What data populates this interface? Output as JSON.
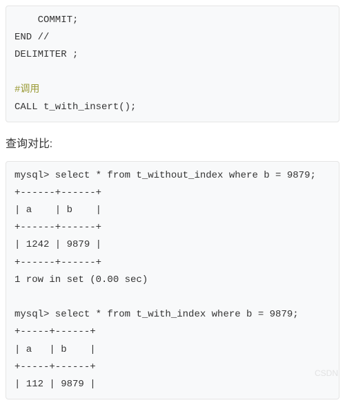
{
  "code1": {
    "line1": "    COMMIT;",
    "line2": "END //",
    "line3": "DELIMITER ;",
    "blank": "",
    "comment": "#调用",
    "line4": "CALL t_with_insert();"
  },
  "prose": {
    "heading": "查询对比:"
  },
  "code2": {
    "l1": "mysql> select * from t_without_index where b = 9879;",
    "l2": "+------+------+",
    "l3": "| a    | b    |",
    "l4": "+------+------+  ",
    "l5": "| 1242 | 9879 |",
    "l6": "+------+------+",
    "l7": "1 row in set (0.00 sec)",
    "blank": "",
    "l8": "mysql> select * from t_with_index where b = 9879;",
    "l9": "+-----+------+",
    "l10": "| a   | b    |",
    "l11": "+-----+------+",
    "l12": "| 112 | 9879 |"
  },
  "watermark": "CSDN"
}
